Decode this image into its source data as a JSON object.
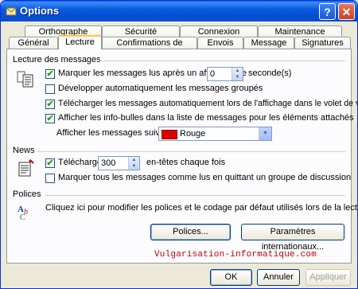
{
  "window": {
    "title": "Options"
  },
  "titlebar": {
    "help_label": "?",
    "close_label": "✕"
  },
  "tabs_back": [
    "Orthographe",
    "Sécurité",
    "Connexion",
    "Maintenance"
  ],
  "tabs_front": [
    "Général",
    "Lecture",
    "Confirmations de lecture",
    "Envois",
    "Message",
    "Signatures"
  ],
  "active_tab": "Lecture",
  "reading": {
    "title": "Lecture des messages",
    "mark_read_label": "Marquer les messages lus après un affichage de",
    "mark_read_value": "0",
    "seconds_label": "seconde(s)",
    "expand_groups_label": "Développer automatiquement les messages groupés",
    "download_auto_label": "Télécharger les messages automatiquement lors de l'affichage dans le volet de visualisation",
    "tooltips_label": "Afficher les info-bulles dans la liste de messages pour les éléments attachés",
    "followed_label": "Afficher les messages suivis en :",
    "followed_color": "Rouge",
    "followed_color_hex": "#e00000",
    "checks": {
      "mark_read": true,
      "expand_groups": false,
      "download_auto": true,
      "tooltips": true
    }
  },
  "news": {
    "title": "News",
    "download_label": "Télécharger",
    "download_value": "300",
    "headers_label": "en-têtes chaque fois",
    "mark_all_label": "Marquer tous les messages comme lus en quittant un groupe de discussion",
    "checks": {
      "download": true,
      "mark_all": false
    }
  },
  "fonts": {
    "title": "Polices",
    "description": "Cliquez ici pour modifier les polices et le codage par défaut utilisés lors de la lecture des messages.",
    "fonts_button": "Polices...",
    "intl_button": "Paramètres internationaux..."
  },
  "watermark": "Vulgarisation-informatique.com",
  "footer": {
    "ok": "OK",
    "cancel": "Annuler",
    "apply": "Appliquer"
  },
  "icons": {
    "title": "outlook-options-icon",
    "reading": "document-list-icon",
    "news": "newsgroup-icon",
    "fonts": "fonts-abc-icon"
  },
  "colors": {
    "titlebar": "#0a5ae0",
    "tab_highlight": "#ffc83c",
    "checkmark": "#21a121",
    "watermark": "#c00000"
  }
}
